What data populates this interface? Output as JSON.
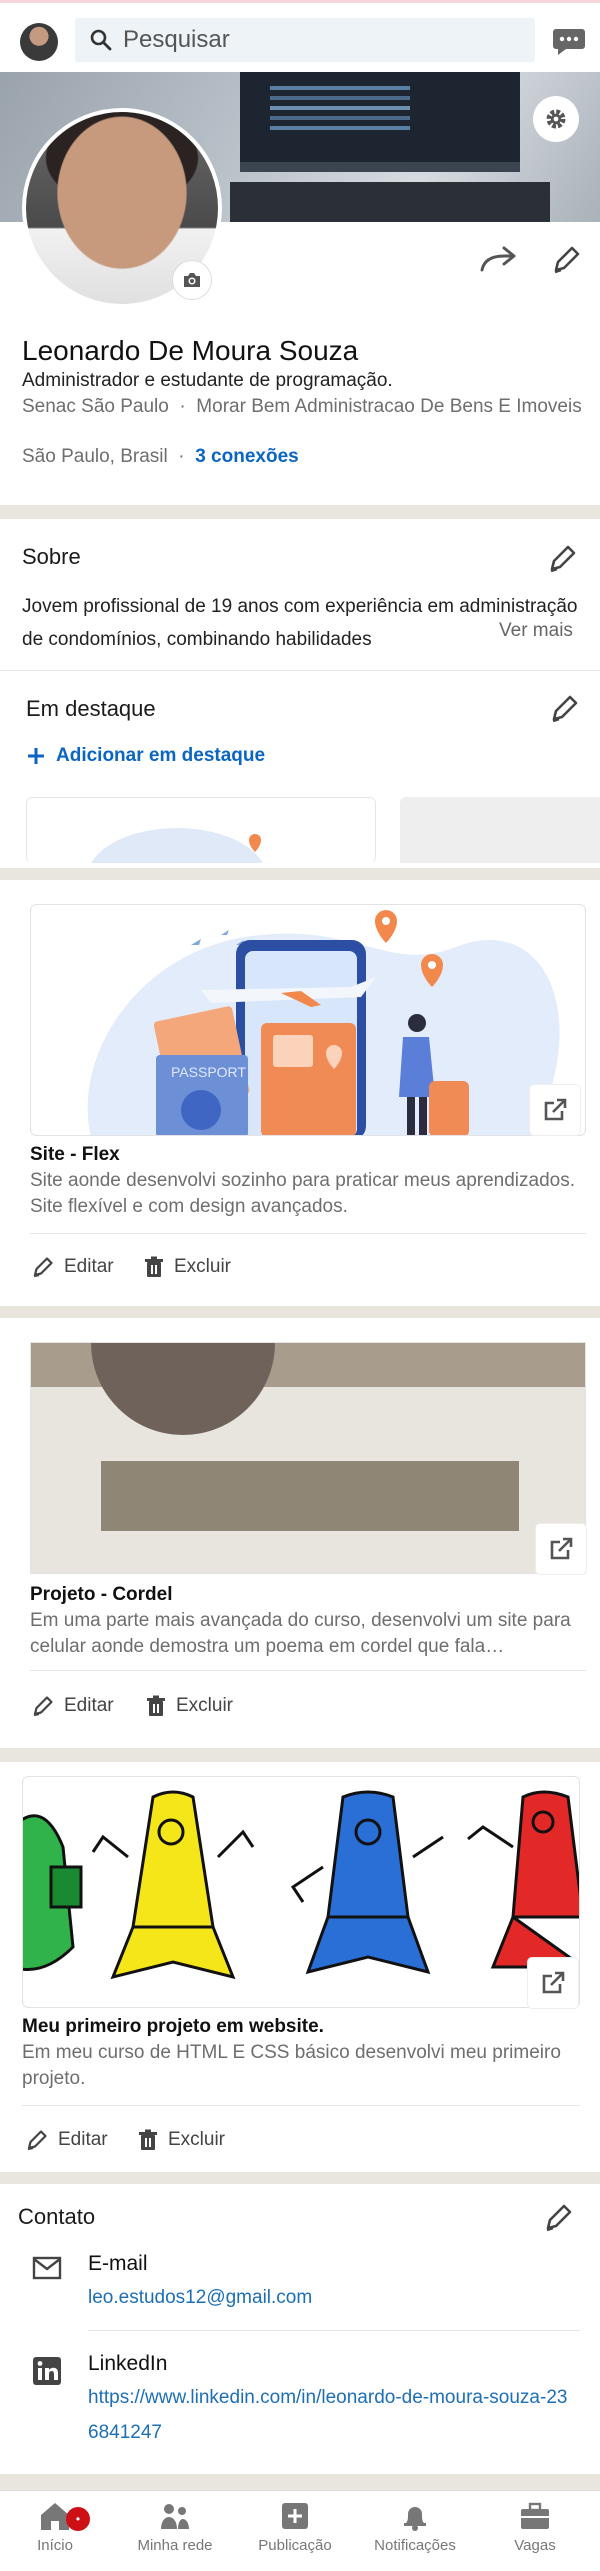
{
  "header": {
    "search_placeholder": "Pesquisar"
  },
  "profile": {
    "name": "Leonardo De Moura Souza",
    "headline": "Administrador e estudante de programação.",
    "education": "Senac São Paulo",
    "company": "Morar Bem Administracao De Bens E Imoveis",
    "location": "São Paulo, Brasil",
    "connections": "3 conexões"
  },
  "about": {
    "title": "Sobre",
    "text": "Jovem profissional de 19 anos com experiência em administração de condomínios, combinando habilidades",
    "see_more": "Ver mais"
  },
  "featured": {
    "title": "Em destaque",
    "add_label": "Adicionar em destaque"
  },
  "projects": [
    {
      "title": "Site - Flex",
      "desc": "Site aonde desenvolvi sozinho para praticar meus aprendizados. Site flexível e com design avançados.",
      "edit": "Editar",
      "delete": "Excluir"
    },
    {
      "title": "Projeto - Cordel",
      "desc": "Em uma parte mais avançada do curso, desenvolvi um site para celular aonde demostra um poema em cordel que fala…",
      "edit": "Editar",
      "delete": "Excluir"
    },
    {
      "title": "Meu primeiro projeto em website.",
      "desc": "Em meu curso de HTML E CSS básico desenvolvi meu primeiro projeto.",
      "edit": "Editar",
      "delete": "Excluir"
    }
  ],
  "contact": {
    "title": "Contato",
    "email_label": "E-mail",
    "email": "leo.estudos12@gmail.com",
    "linkedin_label": "LinkedIn",
    "linkedin_url": "https://www.linkedin.com/in/leonardo-de-moura-souza-236841247"
  },
  "nav": {
    "items": [
      "Início",
      "Minha rede",
      "Publicação",
      "Notificações",
      "Vagas"
    ]
  },
  "colors": {
    "accent": "#0a66c2",
    "badge": "#cc1016"
  }
}
